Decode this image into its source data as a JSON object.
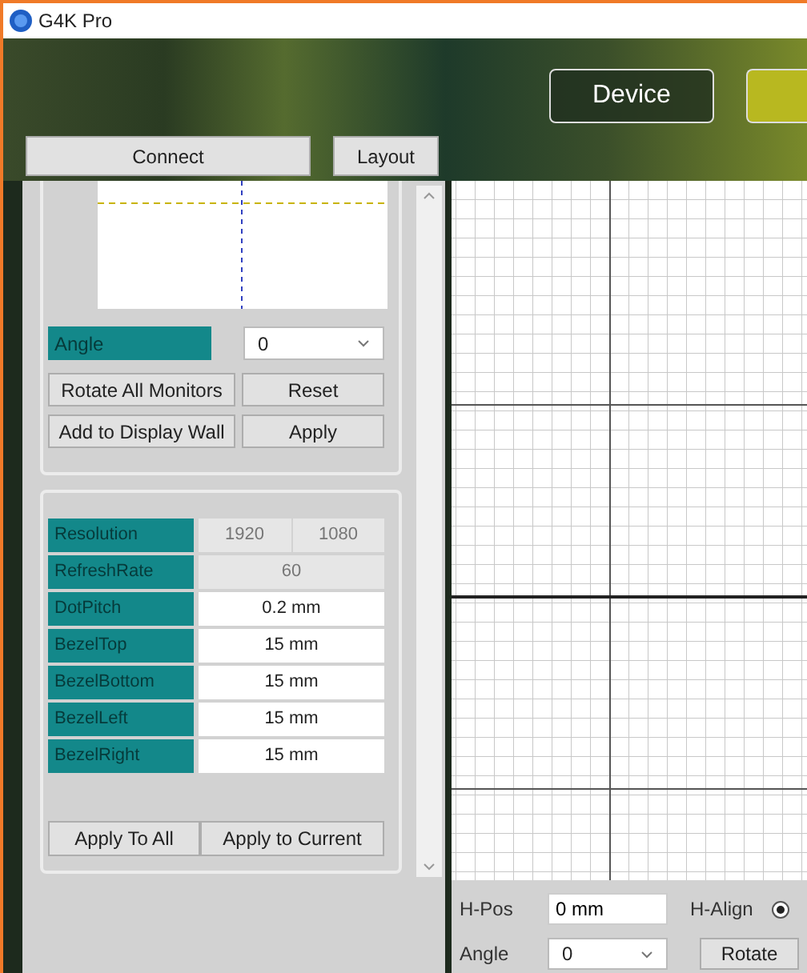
{
  "window": {
    "title": "G4K Pro"
  },
  "header": {
    "device_button": "Device"
  },
  "nav": [
    {
      "label": "Connect"
    },
    {
      "label": "Layout"
    }
  ],
  "rotation": {
    "angle_label": "Angle",
    "angle_value": "0",
    "buttons": [
      "Rotate All Monitors",
      "Reset",
      "Add to Display Wall",
      "Apply"
    ]
  },
  "monitor_properties": {
    "rows": [
      {
        "label": "Resolution",
        "kind": "readonly-pair",
        "values": [
          "1920",
          "1080"
        ]
      },
      {
        "label": "RefreshRate",
        "kind": "readonly",
        "values": [
          "60"
        ]
      },
      {
        "label": "DotPitch",
        "kind": "field",
        "values": [
          "0.2 mm"
        ]
      },
      {
        "label": "BezelTop",
        "kind": "field",
        "values": [
          "15 mm"
        ]
      },
      {
        "label": "BezelBottom",
        "kind": "field",
        "values": [
          "15 mm"
        ]
      },
      {
        "label": "BezelLeft",
        "kind": "field",
        "values": [
          "15 mm"
        ]
      },
      {
        "label": "BezelRight",
        "kind": "field",
        "values": [
          "15 mm"
        ]
      }
    ],
    "buttons": [
      "Apply To All",
      "Apply to Current"
    ]
  },
  "position": {
    "hpos_label": "H-Pos",
    "hpos_value": "0 mm",
    "halign_label": "H-Align",
    "halign_selected": true,
    "angle_label": "Angle",
    "angle_value": "0",
    "rotate_button": "Rotate"
  }
}
